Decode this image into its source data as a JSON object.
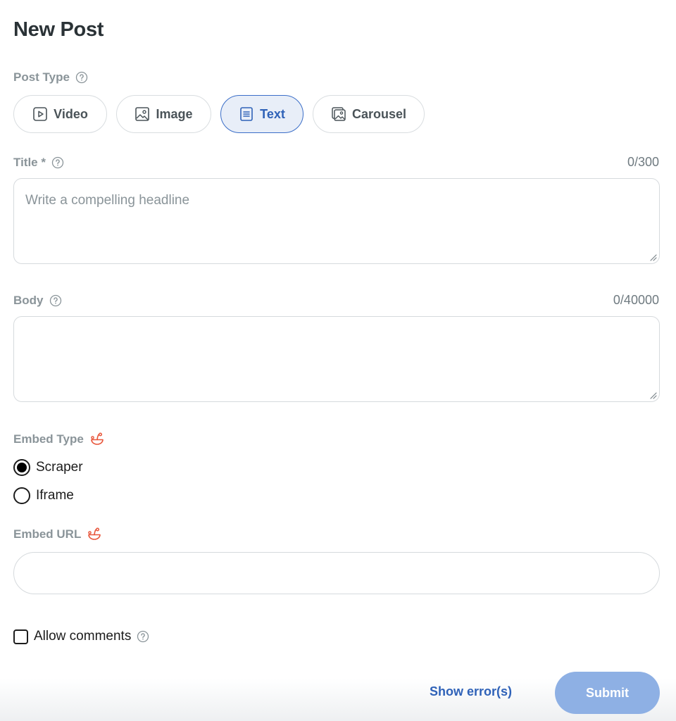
{
  "page": {
    "title": "New Post"
  },
  "post_type": {
    "label": "Post Type",
    "selected": "Text",
    "options": [
      {
        "label": "Video",
        "icon": "video-icon"
      },
      {
        "label": "Image",
        "icon": "image-icon"
      },
      {
        "label": "Text",
        "icon": "text-icon"
      },
      {
        "label": "Carousel",
        "icon": "carousel-icon"
      }
    ]
  },
  "title_field": {
    "label": "Title *",
    "counter": "0/300",
    "value": "",
    "placeholder": "Write a compelling headline"
  },
  "body_field": {
    "label": "Body",
    "counter": "0/40000",
    "value": "",
    "placeholder": ""
  },
  "embed_type": {
    "label": "Embed Type",
    "options": [
      {
        "label": "Scraper",
        "selected": true
      },
      {
        "label": "Iframe",
        "selected": false
      }
    ]
  },
  "embed_url": {
    "label": "Embed URL",
    "value": "",
    "placeholder": ""
  },
  "allow_comments": {
    "label": "Allow comments",
    "checked": false
  },
  "footer": {
    "show_errors_label": "Show error(s)",
    "submit_label": "Submit"
  },
  "colors": {
    "accent": "#2f62b8",
    "selected_chip_bg": "#e8eef8",
    "submit_bg": "#8eb0e4",
    "label_gray": "#8a9499",
    "snoo_orange": "#e8553a"
  }
}
